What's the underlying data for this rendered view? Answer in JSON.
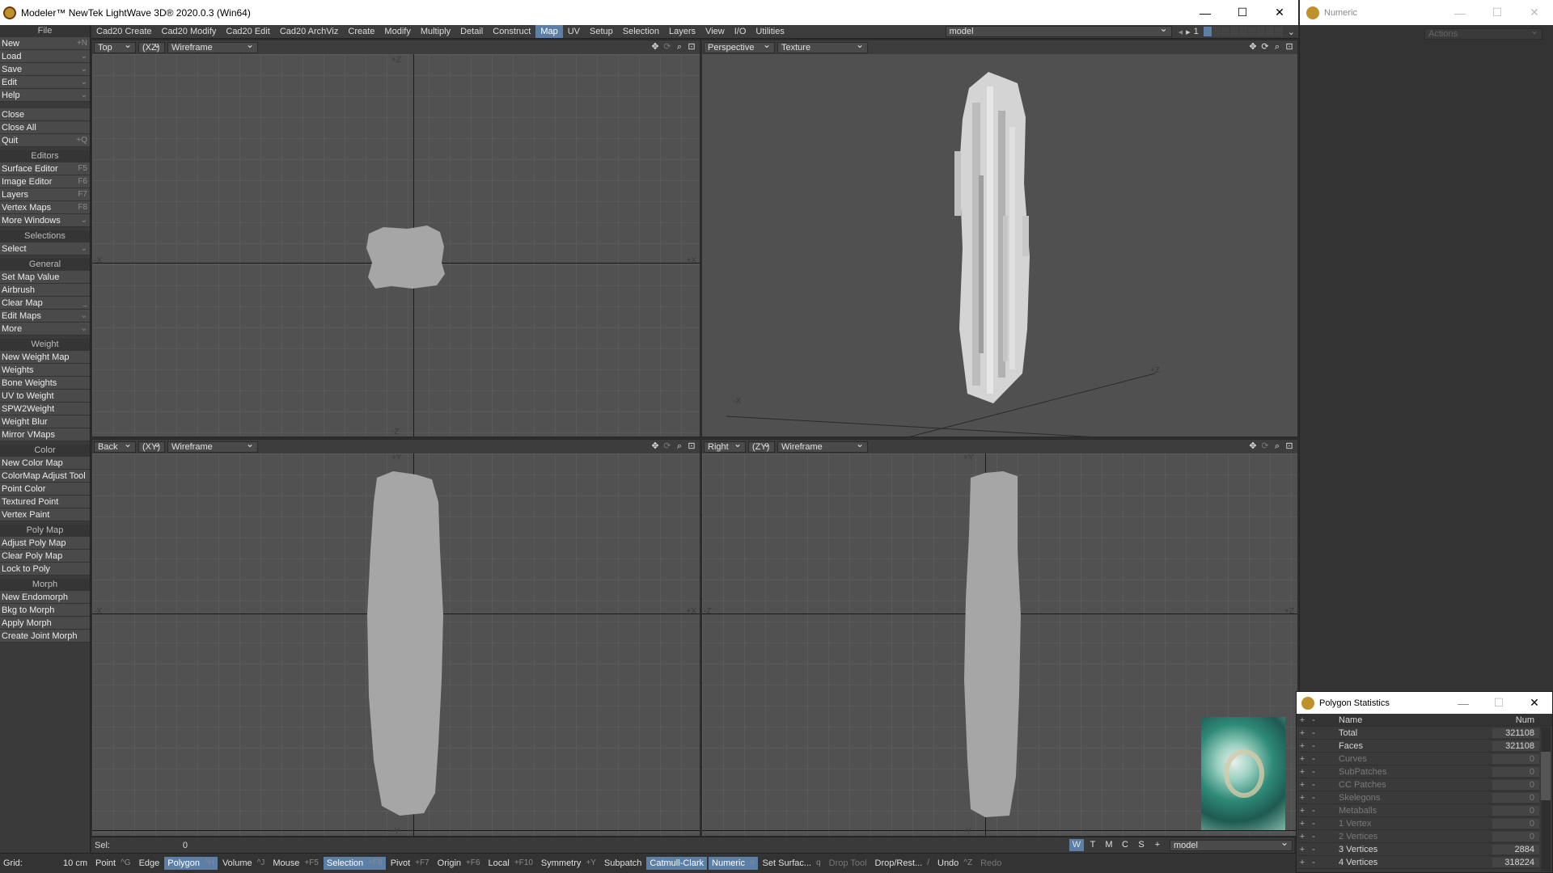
{
  "title": "Modeler™ NewTek LightWave 3D® 2020.0.3 (Win64)",
  "window_controls": [
    "—",
    "☐",
    "✕"
  ],
  "sidebar": {
    "sections": [
      {
        "head": "File",
        "items": [
          {
            "label": "New",
            "sc": "+N"
          },
          {
            "label": "Load",
            "sc": "⌄"
          },
          {
            "label": "Save",
            "sc": "⌄"
          },
          {
            "label": "Edit",
            "sc": "⌄"
          },
          {
            "label": "Help",
            "sc": "⌄"
          }
        ]
      },
      {
        "head": "",
        "items": [
          {
            "label": "Close",
            "sc": ""
          },
          {
            "label": "Close All",
            "sc": ""
          },
          {
            "label": "Quit",
            "sc": "+Q"
          }
        ]
      },
      {
        "head": "Editors",
        "items": [
          {
            "label": "Surface Editor",
            "sc": "F5"
          },
          {
            "label": "Image Editor",
            "sc": "F6"
          },
          {
            "label": "Layers",
            "sc": "F7"
          },
          {
            "label": "Vertex Maps",
            "sc": "F8"
          },
          {
            "label": "More Windows",
            "sc": "⌄"
          }
        ]
      },
      {
        "head": "Selections",
        "items": [
          {
            "label": "Select",
            "sc": "⌄"
          }
        ]
      },
      {
        "head": "General",
        "items": [
          {
            "label": "Set Map Value",
            "sc": ""
          },
          {
            "label": "Airbrush",
            "sc": ""
          },
          {
            "label": "Clear Map",
            "sc": "_"
          },
          {
            "label": "Edit Maps",
            "sc": "⌄"
          },
          {
            "label": "More",
            "sc": "⌄"
          }
        ]
      },
      {
        "head": "Weight",
        "items": [
          {
            "label": "New Weight Map",
            "sc": ""
          },
          {
            "label": "Weights",
            "sc": ""
          },
          {
            "label": "Bone Weights",
            "sc": ""
          },
          {
            "label": "UV to Weight",
            "sc": ""
          },
          {
            "label": "SPW2Weight",
            "sc": ""
          },
          {
            "label": "Weight Blur",
            "sc": ""
          },
          {
            "label": "Mirror VMaps",
            "sc": ""
          }
        ]
      },
      {
        "head": "Color",
        "items": [
          {
            "label": "New Color Map",
            "sc": ""
          },
          {
            "label": "ColorMap Adjust Tool",
            "sc": ""
          },
          {
            "label": "Point Color",
            "sc": ""
          },
          {
            "label": "Textured Point",
            "sc": ""
          },
          {
            "label": "Vertex Paint",
            "sc": ""
          }
        ]
      },
      {
        "head": "Poly Map",
        "items": [
          {
            "label": "Adjust Poly Map",
            "sc": ""
          },
          {
            "label": "Clear Poly Map",
            "sc": ""
          },
          {
            "label": "Lock to Poly",
            "sc": ""
          }
        ]
      },
      {
        "head": "Morph",
        "items": [
          {
            "label": "New Endomorph",
            "sc": ""
          },
          {
            "label": "Bkg to Morph",
            "sc": ""
          },
          {
            "label": "Apply Morph",
            "sc": ""
          },
          {
            "label": "Create Joint Morph",
            "sc": ""
          }
        ]
      }
    ]
  },
  "tabs": [
    "Cad20 Create",
    "Cad20 Modify",
    "Cad20 Edit",
    "Cad20 ArchViz",
    "Create",
    "Modify",
    "Multiply",
    "Detail",
    "Construct",
    "Map",
    "UV",
    "Setup",
    "Selection",
    "Layers",
    "View",
    "I/O",
    "Utilities"
  ],
  "active_tab": "Map",
  "layer_select": "model",
  "layer_number": "1",
  "viewports": {
    "top": {
      "view": "Top",
      "axes": "(XZ)",
      "mode": "Wireframe"
    },
    "persp": {
      "view": "Perspective",
      "mode": "Texture"
    },
    "back": {
      "view": "Back",
      "axes": "(XY)",
      "mode": "Wireframe"
    },
    "right": {
      "view": "Right",
      "axes": "(ZY)",
      "mode": "Wireframe"
    }
  },
  "numeric": {
    "title": "Numeric",
    "actions": "Actions"
  },
  "poly_stats": {
    "title": "Polygon Statistics",
    "col_name": "Name",
    "col_num": "Num",
    "rows": [
      {
        "name": "Total",
        "num": "321108"
      },
      {
        "name": "Faces",
        "num": "321108"
      },
      {
        "name": "Curves",
        "num": "0"
      },
      {
        "name": "SubPatches",
        "num": "0"
      },
      {
        "name": "CC Patches",
        "num": "0"
      },
      {
        "name": "Skelegons",
        "num": "0"
      },
      {
        "name": "Metaballs",
        "num": "0"
      },
      {
        "name": "1 Vertex",
        "num": "0"
      },
      {
        "name": "2 Vertices",
        "num": "0"
      },
      {
        "name": "3 Vertices",
        "num": "2884"
      },
      {
        "name": "4 Vertices",
        "num": "318224"
      }
    ]
  },
  "sel": {
    "label": "Sel:",
    "value": "0"
  },
  "wtmcs": [
    "W",
    "T",
    "M",
    "C",
    "S",
    "+"
  ],
  "bottom_layer": "model",
  "grid": {
    "label": "Grid:",
    "value": "10 cm"
  },
  "bottom_buttons": [
    {
      "label": "Point",
      "sc": "^G"
    },
    {
      "label": "Edge",
      "sc": ""
    },
    {
      "label": "Polygon",
      "sc": "^H"
    },
    {
      "label": "Volume",
      "sc": "^J"
    },
    {
      "label": "Mouse",
      "sc": "+F5"
    },
    {
      "label": "Selection",
      "sc": "+F8"
    },
    {
      "label": "Pivot",
      "sc": "+F7"
    },
    {
      "label": "Origin",
      "sc": "+F6"
    },
    {
      "label": "Local",
      "sc": "+F10"
    },
    {
      "label": "Symmetry",
      "sc": "+Y"
    },
    {
      "label": "Subpatch",
      "sc": ""
    },
    {
      "label": "Catmull-Clark",
      "sc": ""
    },
    {
      "label": "Numeric",
      "sc": "n"
    },
    {
      "label": "Set Surfac...",
      "sc": "q"
    },
    {
      "label": "Drop Tool",
      "sc": ""
    },
    {
      "label": "Drop/Rest...",
      "sc": "/"
    },
    {
      "label": "Undo",
      "sc": "^Z"
    },
    {
      "label": "Redo",
      "sc": ""
    }
  ]
}
